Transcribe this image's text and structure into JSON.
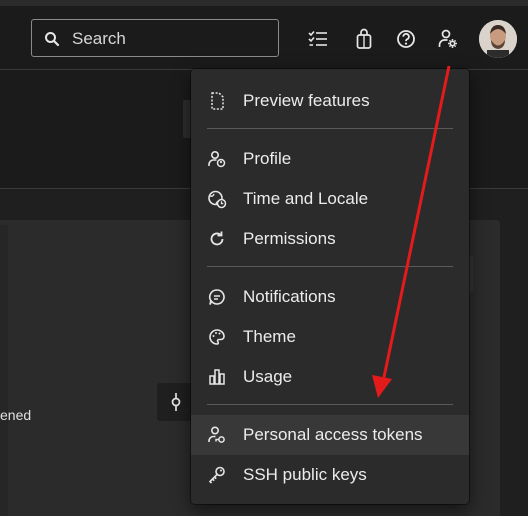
{
  "header": {
    "search": {
      "placeholder": "Search"
    },
    "icons": [
      "search-icon",
      "task-list-icon",
      "shopping-bag-icon",
      "help-icon",
      "user-settings-icon"
    ]
  },
  "background": {
    "fragment_text": "ened"
  },
  "menu": {
    "sections": [
      {
        "items": [
          {
            "label": "Preview features",
            "icon": "document-icon"
          }
        ]
      },
      {
        "items": [
          {
            "label": "Profile",
            "icon": "profile-icon"
          },
          {
            "label": "Time and Locale",
            "icon": "globe-clock-icon"
          },
          {
            "label": "Permissions",
            "icon": "refresh-icon"
          }
        ]
      },
      {
        "items": [
          {
            "label": "Notifications",
            "icon": "chat-icon"
          },
          {
            "label": "Theme",
            "icon": "palette-icon"
          },
          {
            "label": "Usage",
            "icon": "bar-chart-icon"
          }
        ]
      },
      {
        "items": [
          {
            "label": "Personal access tokens",
            "icon": "person-key-icon",
            "hovered": true
          },
          {
            "label": "SSH public keys",
            "icon": "key-icon"
          }
        ]
      }
    ]
  },
  "annotation": {
    "color": "#e31b1b",
    "target": "Personal access tokens"
  }
}
